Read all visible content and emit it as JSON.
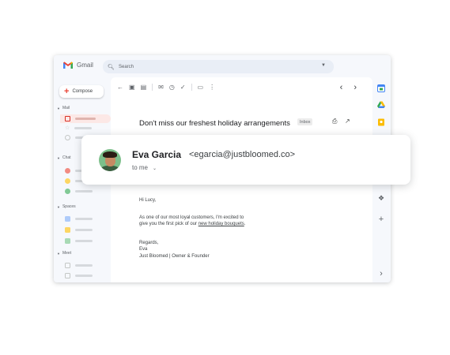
{
  "app": {
    "name": "Gmail"
  },
  "search": {
    "placeholder": "Search"
  },
  "compose": {
    "label": "Compose"
  },
  "sidebar": {
    "sections": [
      {
        "label": "Mail"
      },
      {
        "label": "Chat"
      },
      {
        "label": "Spaces"
      },
      {
        "label": "Meet"
      }
    ]
  },
  "email": {
    "subject": "Don't miss our freshest holiday arrangements",
    "label_tag": "Inbox",
    "sender_name": "Eva Garcia",
    "sender_email": "<egarcia@justbloomed.co>",
    "recipient": "to me",
    "greeting": "Hi Lucy,",
    "line1": "As one of our most loyal customers, I'm excited to",
    "line2_prefix": "give you the first pick of our ",
    "line2_link": "new holiday bouquets",
    "line2_suffix": ".",
    "closing": "Regards,",
    "sign_name": "Eva",
    "sign_title": "Just Bloomed | Owner & Founder"
  },
  "colors": {
    "gmail_red": "#ea4335",
    "accent_blue": "#1a73e8",
    "chat_red": "#f28b82",
    "chat_yellow": "#fdd663",
    "chat_green": "#81c995"
  }
}
